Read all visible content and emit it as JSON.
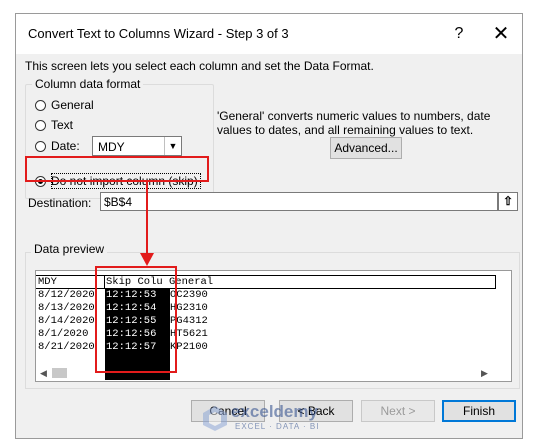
{
  "window": {
    "title": "Convert Text to Columns Wizard - Step 3 of 3",
    "help_icon": "?",
    "close_icon": "✕"
  },
  "intro_text": "This screen lets you select each column and set the Data Format.",
  "column_format": {
    "group_label": "Column data format",
    "options": [
      {
        "label": "General",
        "checked": false
      },
      {
        "label": "Text",
        "checked": false
      },
      {
        "label": "Date:",
        "checked": false
      },
      {
        "label": "Do not import column (skip)",
        "checked": true
      }
    ],
    "date_value": "MDY"
  },
  "general_description": "'General' converts numeric values to numbers, date values to dates, and all remaining values to text.",
  "advanced_button": "Advanced...",
  "destination": {
    "label": "Destination:",
    "value": "$B$4"
  },
  "preview": {
    "label": "Data preview",
    "headers": [
      "MDY",
      "Skip Colu",
      "General"
    ],
    "rows": [
      [
        "8/12/2020",
        "12:12:53",
        "OC2390"
      ],
      [
        "8/13/2020",
        "12:12:54",
        "HG2310"
      ],
      [
        "8/14/2020",
        "12:12:55",
        "PG4312"
      ],
      [
        "8/1/2020",
        "12:12:56",
        "HT5621"
      ],
      [
        "8/21/2020",
        "12:12:57",
        "KP2100"
      ]
    ]
  },
  "buttons": {
    "cancel": "Cancel",
    "back": "< Back",
    "next": "Next >",
    "finish": "Finish"
  },
  "watermark": {
    "name": "exceldemy",
    "tagline": "EXCEL · DATA · BI"
  },
  "colors": {
    "annotation_red": "#e21b1b",
    "focus_blue": "#0078d7"
  }
}
